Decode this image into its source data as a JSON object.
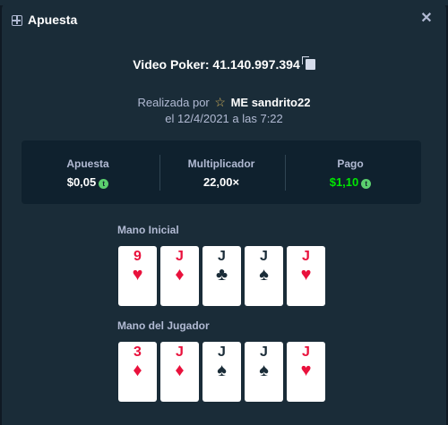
{
  "header": {
    "title": "Apuesta"
  },
  "game": {
    "title": "Video Poker: 41.140.997.394"
  },
  "placed": {
    "prefix": "Realizada por",
    "username": "ME sandrito22",
    "date": "el 12/4/2021 a las 7:22"
  },
  "stats": [
    {
      "label": "Apuesta",
      "value": "$0,05"
    },
    {
      "label": "Multiplicador",
      "value": "22,00×"
    },
    {
      "label": "Pago",
      "value": "$1,10"
    }
  ],
  "colors": {
    "background": "#1a2c38",
    "panel": "#0f212e",
    "payout": "#00e701",
    "red_suit": "#e9113c"
  },
  "hands": [
    {
      "label": "Mano Inicial",
      "cards": [
        {
          "rank": "9",
          "suit": "♥",
          "color": "red"
        },
        {
          "rank": "J",
          "suit": "♦",
          "color": "red"
        },
        {
          "rank": "J",
          "suit": "♣",
          "color": "black"
        },
        {
          "rank": "J",
          "suit": "♠",
          "color": "black"
        },
        {
          "rank": "J",
          "suit": "♥",
          "color": "red"
        }
      ]
    },
    {
      "label": "Mano del Jugador",
      "cards": [
        {
          "rank": "3",
          "suit": "♦",
          "color": "red"
        },
        {
          "rank": "J",
          "suit": "♦",
          "color": "red"
        },
        {
          "rank": "J",
          "suit": "♠",
          "color": "black"
        },
        {
          "rank": "J",
          "suit": "♠",
          "color": "black"
        },
        {
          "rank": "J",
          "suit": "♥",
          "color": "red"
        }
      ]
    }
  ]
}
